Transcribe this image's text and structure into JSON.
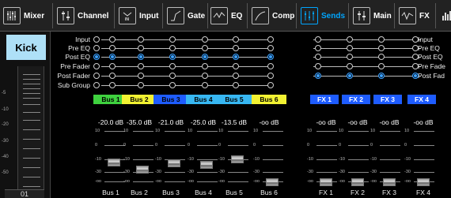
{
  "tabs": [
    {
      "label": "Mixer",
      "icon": "mixer-icon"
    },
    {
      "label": "Channel",
      "icon": "channel-icon"
    },
    {
      "label": "Input",
      "icon": "input-icon"
    },
    {
      "label": "Gate",
      "icon": "gate-icon"
    },
    {
      "label": "EQ",
      "icon": "eq-icon"
    },
    {
      "label": "Comp",
      "icon": "comp-icon"
    },
    {
      "label": "Sends",
      "icon": "sends-icon",
      "active": true
    },
    {
      "label": "Main",
      "icon": "main-icon"
    },
    {
      "label": "FX",
      "icon": "fx-icon"
    }
  ],
  "channel": {
    "name": "Kick",
    "number": "01",
    "meter_labels": [
      "-5",
      "-10",
      "-20",
      "-30",
      "-40",
      "-50"
    ]
  },
  "sources": [
    "Input",
    "Pre EQ",
    "Post EQ",
    "Pre Fader",
    "Post Fader",
    "Sub Group"
  ],
  "fx_sources": [
    "Input",
    "Pre EQ",
    "Post EQ",
    "Pre Fade",
    "Post Fad"
  ],
  "buses": [
    {
      "label": "Bus 1",
      "value": "-20.0 dB",
      "name": "Bus 1",
      "color": "#3fd13f",
      "selected": 2,
      "fader": 0.58
    },
    {
      "label": "Bus 2",
      "value": "-35.0 dB",
      "name": "Bus 2",
      "color": "#f2f232",
      "selected": 2,
      "fader": 0.74
    },
    {
      "label": "Bus 3",
      "value": "-21.0 dB",
      "name": "Bus 3",
      "color": "#1e5cff",
      "selected": 2,
      "fader": 0.6
    },
    {
      "label": "Bus 4",
      "value": "-25.0 dB",
      "name": "Bus 4",
      "color": "#37b7f2",
      "selected": 2,
      "fader": 0.64
    },
    {
      "label": "Bus 5",
      "value": "-13.5 dB",
      "name": "Bus 5",
      "color": "#37b7f2",
      "selected": 2,
      "fader": 0.52
    },
    {
      "label": "Bus 6",
      "value": "-oo dB",
      "name": "Bus 6",
      "color": "#f2f232",
      "selected": 2,
      "fader": 1.0
    }
  ],
  "fx": [
    {
      "label": "FX 1",
      "value": "-oo dB",
      "name": "FX 1",
      "color": "#1e5cff",
      "selected": 4,
      "fader": 1.0
    },
    {
      "label": "FX 2",
      "value": "-oo dB",
      "name": "FX 2",
      "color": "#1e5cff",
      "selected": 4,
      "fader": 1.0
    },
    {
      "label": "FX 3",
      "value": "-oo dB",
      "name": "FX 3",
      "color": "#1e5cff",
      "selected": 4,
      "fader": 1.0
    },
    {
      "label": "FX 4",
      "value": "-oo dB",
      "name": "FX 4",
      "color": "#1e5cff",
      "selected": 4,
      "fader": 1.0
    }
  ],
  "scale": [
    "10",
    "0",
    "-10",
    "-30",
    "-oo"
  ],
  "accent": "#00a6ff"
}
